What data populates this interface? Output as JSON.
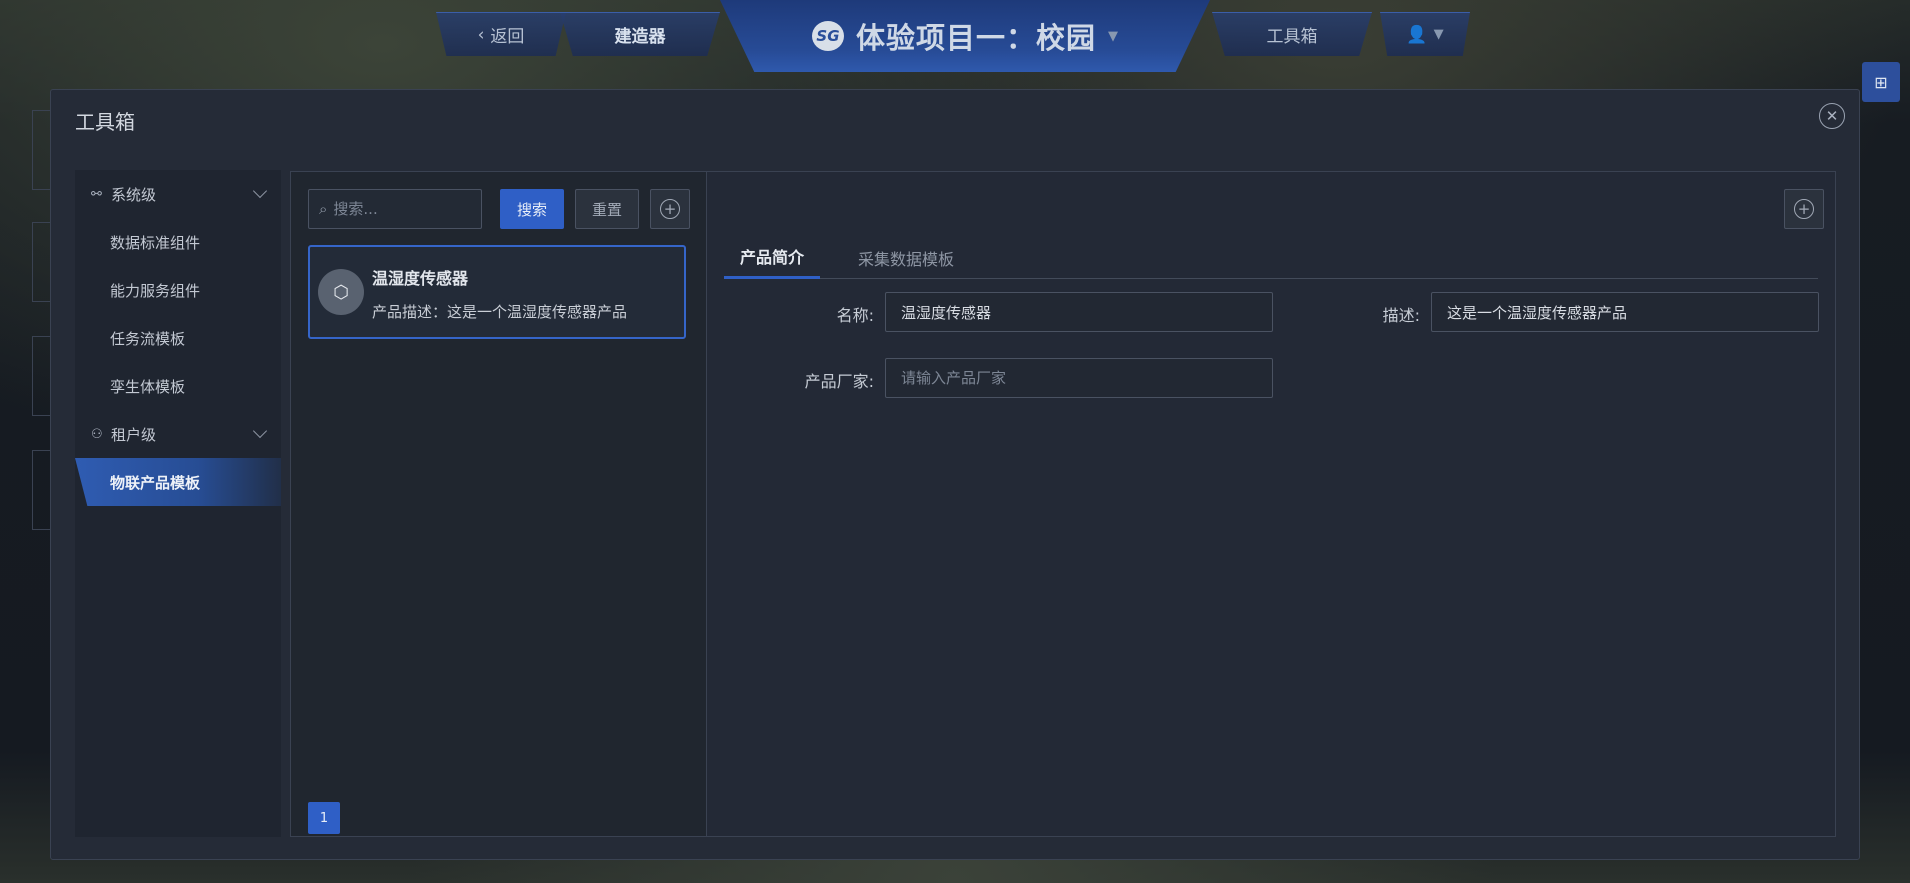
{
  "topbar": {
    "back_label": "返回",
    "builder_label": "建造器",
    "project_title": "体验项目一：校园",
    "logo_text": "SG",
    "toolbox_label": "工具箱"
  },
  "dialog": {
    "title": "工具箱",
    "close_glyph": "✕"
  },
  "sidebar": {
    "groups": [
      {
        "label": "系统级",
        "icon": "hierarchy-icon"
      },
      {
        "label": "租户级",
        "icon": "user-icon"
      }
    ],
    "items": [
      {
        "label": "数据标准组件"
      },
      {
        "label": "能力服务组件"
      },
      {
        "label": "任务流模板"
      },
      {
        "label": "孪生体模板"
      },
      {
        "label": "物联产品模板",
        "active": true
      }
    ]
  },
  "list": {
    "search_placeholder": "搜索...",
    "search_button": "搜索",
    "reset_button": "重置",
    "cards": [
      {
        "title": "温湿度传感器",
        "desc": "产品描述：这是一个温湿度传感器产品"
      }
    ],
    "page": "1"
  },
  "detail": {
    "tabs": [
      {
        "label": "产品简介",
        "active": true
      },
      {
        "label": "采集数据模板",
        "active": false
      }
    ],
    "fields": {
      "name_label": "名称:",
      "name_value": "温湿度传感器",
      "desc_label": "描述:",
      "desc_value": "这是一个温湿度传感器产品",
      "vendor_label": "产品厂家:",
      "vendor_placeholder": "请输入产品厂家"
    }
  },
  "colors": {
    "accent": "#2f5fc6",
    "panel": "#252b37",
    "active_nav": "#2f5cb2"
  }
}
